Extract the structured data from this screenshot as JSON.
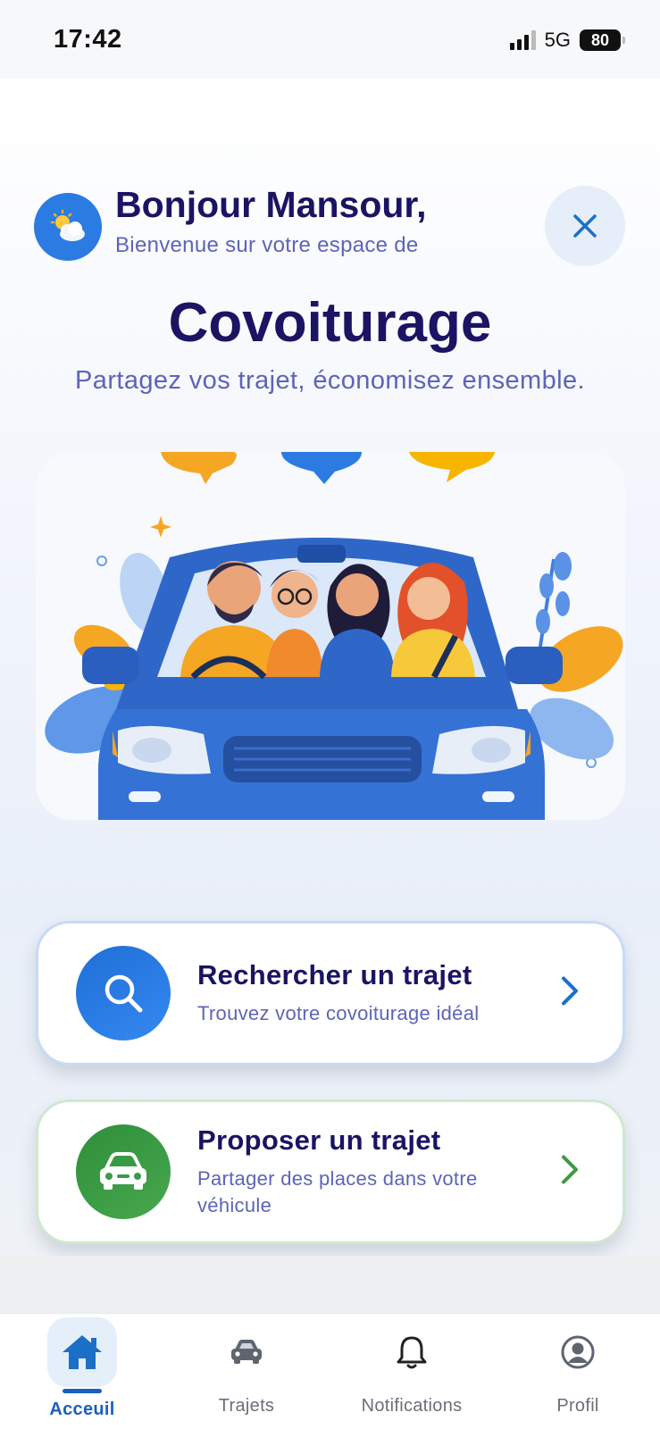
{
  "status_bar": {
    "time": "17:42",
    "network": "5G",
    "battery": "80"
  },
  "header": {
    "avatar_icon": "sun-behind-cloud-icon",
    "greeting": "Bonjour Mansour,",
    "welcome": "Bienvenue sur votre espace de",
    "close_icon": "close-icon"
  },
  "hero": {
    "title": "Covoiturage",
    "subtitle": "Partagez vos trajet, économisez ensemble."
  },
  "illustration": {
    "description_icon": "carpool-illustration"
  },
  "actions": [
    {
      "title": "Rechercher un trajet",
      "subtitle": "Trouvez votre covoiturage idéal",
      "icon": "search-icon",
      "color": "#2b7be3"
    },
    {
      "title": "Proposer un trajet",
      "subtitle": "Partager des places dans votre véhicule",
      "icon": "car-icon",
      "color": "#3d9a45"
    }
  ],
  "tabs": [
    {
      "label": "Acceuil",
      "icon": "home-icon",
      "active": true
    },
    {
      "label": "Trajets",
      "icon": "car-icon",
      "active": false
    },
    {
      "label": "Notifications",
      "icon": "bell-icon",
      "active": false
    },
    {
      "label": "Profil",
      "icon": "user-circle-icon",
      "active": false
    }
  ],
  "colors": {
    "primary": "#1a1463",
    "accent_blue": "#1b5fbf",
    "accent_green": "#3d9a45",
    "secondary_text": "#5d64b8"
  }
}
